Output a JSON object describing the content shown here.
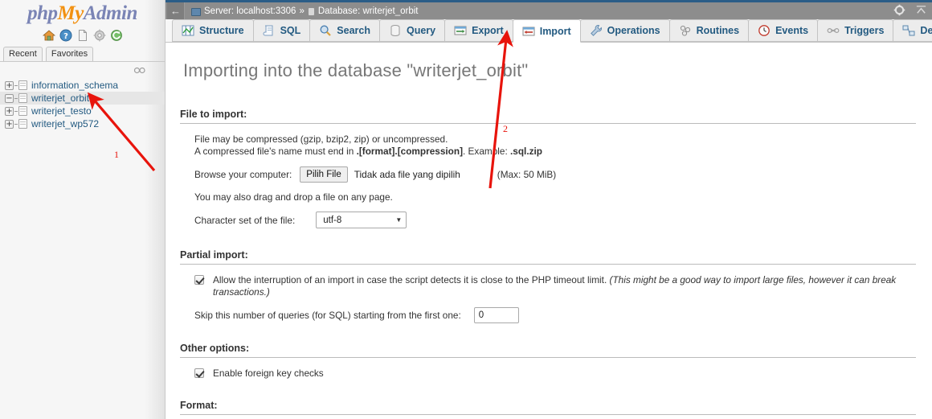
{
  "sidebar": {
    "logo": {
      "php": "php",
      "my": "My",
      "admin": "Admin"
    },
    "quick_icons": [
      {
        "name": "home-icon",
        "title": "Home"
      },
      {
        "name": "help-icon",
        "title": "Documentation"
      },
      {
        "name": "doc-icon",
        "title": "phpMyAdmin documentation"
      },
      {
        "name": "gear-icon",
        "title": "Settings"
      },
      {
        "name": "reload-icon",
        "title": "Reload navigation"
      }
    ],
    "mini_tabs": [
      {
        "label": "Recent"
      },
      {
        "label": "Favorites"
      }
    ],
    "chain_icon": "link-icon",
    "databases": [
      {
        "label": "information_schema",
        "expander": "+",
        "selected": false
      },
      {
        "label": "writerjet_orbit",
        "expander": "−",
        "selected": true
      },
      {
        "label": "writerjet_testo",
        "expander": "+",
        "selected": false
      },
      {
        "label": "writerjet_wp572",
        "expander": "+",
        "selected": false
      }
    ]
  },
  "breadcrumb": {
    "back_arrow": "←",
    "server_label": "Server: localhost:3306",
    "separator": "»",
    "database_label": "Database: writerjet_orbit",
    "right_icons": [
      {
        "name": "gear-icon"
      },
      {
        "name": "collapse-icon"
      }
    ]
  },
  "tabs": [
    {
      "label": "Structure",
      "icon": "structure-icon",
      "active": false
    },
    {
      "label": "SQL",
      "icon": "sql-icon",
      "active": false
    },
    {
      "label": "Search",
      "icon": "search-icon",
      "active": false
    },
    {
      "label": "Query",
      "icon": "query-icon",
      "active": false
    },
    {
      "label": "Export",
      "icon": "export-icon",
      "active": false
    },
    {
      "label": "Import",
      "icon": "import-icon",
      "active": true
    },
    {
      "label": "Operations",
      "icon": "wrench-icon",
      "active": false
    },
    {
      "label": "Routines",
      "icon": "routines-icon",
      "active": false
    },
    {
      "label": "Events",
      "icon": "clock-icon",
      "active": false
    },
    {
      "label": "Triggers",
      "icon": "triggers-icon",
      "active": false
    },
    {
      "label": "Designer",
      "icon": "designer-icon",
      "active": false
    }
  ],
  "page": {
    "title": "Importing into the database \"writerjet_orbit\"",
    "file_to_import": {
      "heading": "File to import:",
      "line1": "File may be compressed (gzip, bzip2, zip) or uncompressed.",
      "line2_a": "A compressed file's name must end in ",
      "line2_b": ".[format].[compression]",
      "line2_c": ". Example: ",
      "line2_d": ".sql.zip",
      "browse_label": "Browse your computer:",
      "file_button": "Pilih File",
      "file_status": "Tidak ada file yang dipilih",
      "max_size": "(Max: 50 MiB)",
      "dragdrop": "You may also drag and drop a file on any page.",
      "charset_label": "Character set of the file:",
      "charset_value": "utf-8"
    },
    "partial_import": {
      "heading": "Partial import:",
      "allow_text": "Allow the interruption of an import in case the script detects it is close to the PHP timeout limit.",
      "allow_note": "(This might be a good way to import large files, however it can break transactions.)",
      "allow_checked": true,
      "skip_label": "Skip this number of queries (for SQL) starting from the first one:",
      "skip_value": "0"
    },
    "other_options": {
      "heading": "Other options:",
      "fk_label": "Enable foreign key checks",
      "fk_checked": true
    },
    "format": {
      "heading": "Format:"
    }
  },
  "annotations": [
    {
      "id": "1",
      "label": "1",
      "color": "#e8140c"
    },
    {
      "id": "2",
      "label": "2",
      "color": "#e8140c"
    }
  ]
}
